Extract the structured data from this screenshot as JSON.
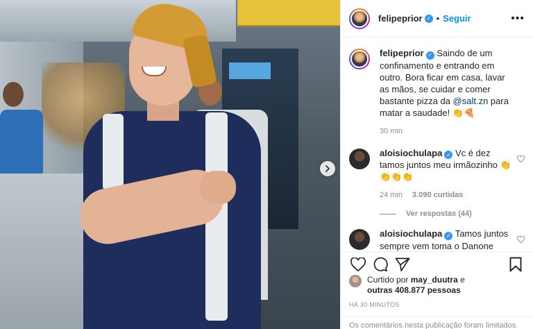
{
  "post": {
    "author": "felipeprior",
    "follow_label": "Seguir",
    "dot": "•",
    "more_icon": "more-horizontal-icon"
  },
  "caption": {
    "author": "felipeprior",
    "text_before": "Saindo de um confinamento e entrando em outro. Bora ficar em casa, lavar as mãos, se cuidar e comer bastante pizza da ",
    "mention": "@salt.zn",
    "text_after": " para matar a saudade! 👏🍕",
    "time": "30 min"
  },
  "comments": [
    {
      "author": "aloisiochulapa",
      "text": "Vc é dez tamos juntos meu irmãozinho 👏👏👏👏",
      "time": "24 min",
      "likes": "3.090 curtidas",
      "replies": "Ver respostas (44)"
    },
    {
      "author": "aloisiochulapa",
      "text": "Tamos juntos sempre vem toma o Danone duplo aqui em casa com chula o"
    }
  ],
  "liked_by": {
    "prefix": "Curtido por",
    "user": "may_duutra",
    "connector": "e",
    "others": "outras 408.877 pessoas"
  },
  "timestamp": "HÁ 30 MINUTOS",
  "limited_notice": "Os comentários nesta publicação foram limitados.",
  "icons": {
    "like": "heart-icon",
    "comment": "comment-icon",
    "share": "share-icon",
    "save": "bookmark-icon",
    "next": "chevron-right-icon"
  },
  "colors": {
    "link": "#0095f6",
    "verified": "#3897f0",
    "text": "#262626",
    "muted": "#8e8e8e"
  }
}
